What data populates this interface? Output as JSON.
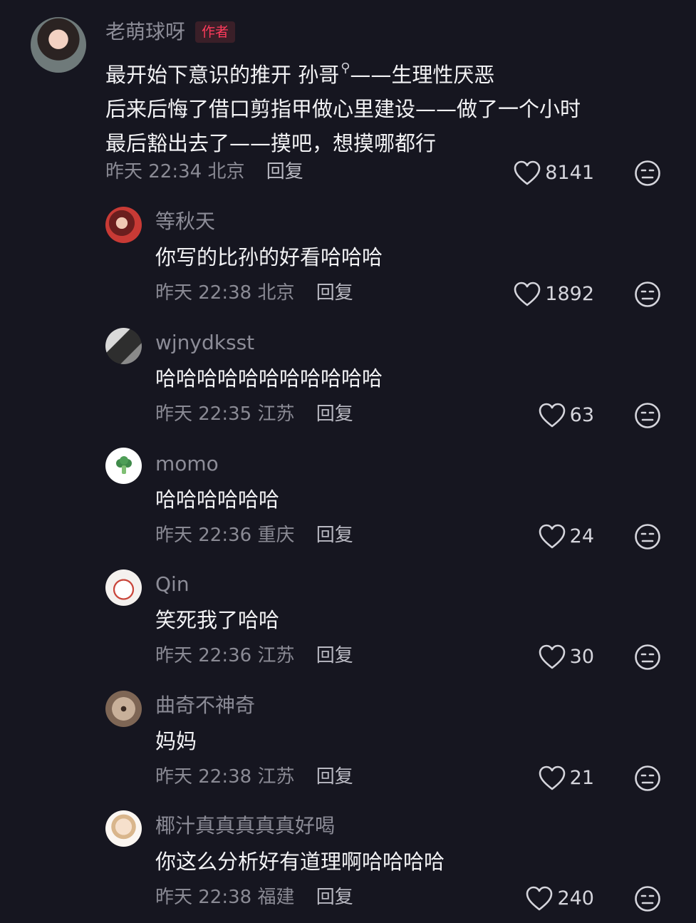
{
  "comments": [
    {
      "username": "老萌球呀",
      "badge": "作者",
      "lines": [
        "最开始下意识的推开 孙哥",
        "后来后悔了借口剪指甲做心里建设——做了一个小时",
        "最后豁出去了——摸吧，想摸哪都行"
      ],
      "line1_suffix": "——生理性厌恶",
      "time": "昨天 22:34",
      "location": "北京",
      "reply_label": "回复",
      "likes": "8141"
    },
    {
      "username": "等秋天",
      "lines": [
        "你写的比孙的好看哈哈哈"
      ],
      "time": "昨天 22:38",
      "location": "北京",
      "reply_label": "回复",
      "likes": "1892"
    },
    {
      "username": "wjnydksst",
      "lines": [
        "哈哈哈哈哈哈哈哈哈哈哈"
      ],
      "time": "昨天 22:35",
      "location": "江苏",
      "reply_label": "回复",
      "likes": "63"
    },
    {
      "username": "momo",
      "lines": [
        "哈哈哈哈哈哈"
      ],
      "time": "昨天 22:36",
      "location": "重庆",
      "reply_label": "回复",
      "likes": "24"
    },
    {
      "username": "Qin",
      "lines": [
        "笑死我了哈哈"
      ],
      "time": "昨天 22:36",
      "location": "江苏",
      "reply_label": "回复",
      "likes": "30"
    },
    {
      "username": "曲奇不神奇",
      "lines": [
        "妈妈"
      ],
      "time": "昨天 22:38",
      "location": "江苏",
      "reply_label": "回复",
      "likes": "21"
    },
    {
      "username": "椰汁真真真真真好喝",
      "lines": [
        "你这么分析好有道理啊哈哈哈哈"
      ],
      "time": "昨天 22:38",
      "location": "福建",
      "reply_label": "回复",
      "likes": "240"
    }
  ],
  "icons": {
    "like": "heart-outline-icon",
    "dislike": "dislike-face-icon",
    "search_glyph": "search-icon"
  },
  "colors": {
    "background": "#161620",
    "author_badge": "#ff3b5c",
    "username": "#8c8c97",
    "meta": "#8a8a94"
  }
}
